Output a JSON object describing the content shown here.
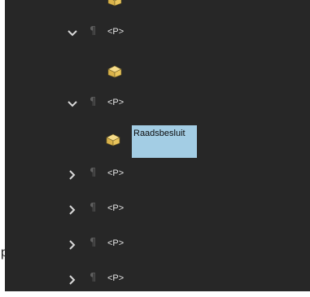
{
  "outside_text": "p",
  "tree": {
    "selected_label": "Raadsbesluit",
    "nodes": [
      {
        "type": "element",
        "tag": "<P>",
        "state": "expanded"
      },
      {
        "type": "element",
        "tag": "<P>",
        "state": "expanded"
      },
      {
        "type": "element",
        "tag": "<P>",
        "state": "collapsed"
      },
      {
        "type": "element",
        "tag": "<P>",
        "state": "collapsed"
      },
      {
        "type": "element",
        "tag": "<P>",
        "state": "collapsed"
      },
      {
        "type": "element",
        "tag": "<P>",
        "state": "collapsed"
      }
    ]
  },
  "icons": {
    "expander_expanded": "chevron-down-icon",
    "expander_collapsed": "chevron-right-icon",
    "paragraph": "pilcrow-icon",
    "content_box": "box-icon"
  },
  "colors": {
    "panel_bg": "#272727",
    "selection_bg": "#a3cde4",
    "tag_text": "#e6e6e6",
    "chevron": "#d9d9d9"
  }
}
